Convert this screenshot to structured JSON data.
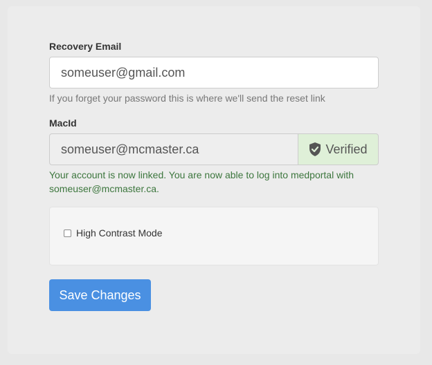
{
  "recovery_email": {
    "label": "Recovery Email",
    "value": "someuser@gmail.com",
    "help": "If you forget your password this is where we'll send the reset link"
  },
  "macid": {
    "label": "MacId",
    "value": "someuser@mcmaster.ca",
    "status_label": "Verified",
    "status_icon": "shield-check-icon",
    "success_line1": "Your account is now linked. You are now able to log into medportal with",
    "success_line2": "someuser@mcmaster.ca."
  },
  "options": {
    "high_contrast_label": "High Contrast Mode",
    "high_contrast_checked": false
  },
  "actions": {
    "save_label": "Save Changes"
  },
  "colors": {
    "primary": "#4a90e2",
    "success_bg": "#dff0d8",
    "success_text": "#3c763d"
  }
}
